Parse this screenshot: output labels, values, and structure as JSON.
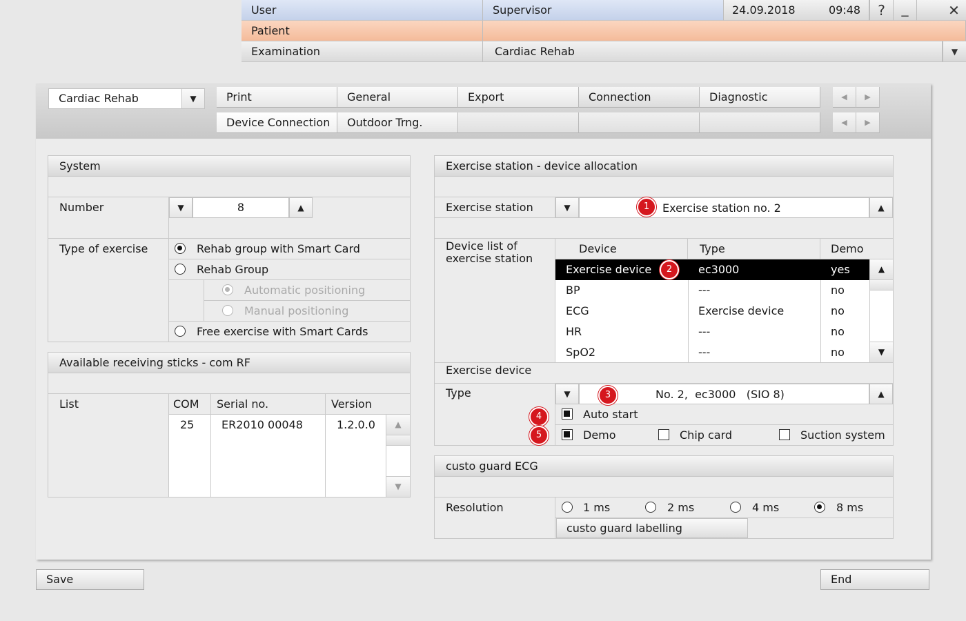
{
  "header": {
    "user_label": "User",
    "user_value": "Supervisor",
    "date": "24.09.2018",
    "time": "09:48",
    "help_icon": "?",
    "minimize_icon": "_",
    "close_icon": "✕",
    "patient_label": "Patient",
    "patient_value": "",
    "examination_label": "Examination",
    "examination_value": "Cardiac Rehab",
    "colors": {
      "blue": "#c4d1ea",
      "patient": "#f4bb9a"
    }
  },
  "module": {
    "selected": "Cardiac Rehab"
  },
  "tabs": {
    "row1": [
      "Print",
      "General",
      "Export",
      "Connection",
      "Diagnostic"
    ],
    "row2": [
      "Device Connection",
      "Outdoor Trng.",
      "",
      "",
      ""
    ],
    "active_row1": "Connection",
    "active_row2": "Device Connection"
  },
  "system": {
    "title": "System",
    "number_label": "Number",
    "number_value": "8",
    "type_label": "Type of exercise",
    "options": [
      {
        "label": "Rehab group with Smart Card",
        "selected": true
      },
      {
        "label": "Rehab Group",
        "selected": false
      },
      {
        "label": "Automatic positioning",
        "selected": true,
        "disabled": true
      },
      {
        "label": "Manual positioning",
        "selected": false,
        "disabled": true
      },
      {
        "label": "Free exercise with Smart Cards",
        "selected": false
      }
    ]
  },
  "sticks": {
    "title": "Available receiving sticks - com RF",
    "list_label": "List",
    "columns": [
      "COM",
      "Serial no.",
      "Version"
    ],
    "rows": [
      [
        "25",
        "ER2010 00048",
        "1.2.0.0"
      ]
    ]
  },
  "allocation": {
    "title": "Exercise station - device allocation",
    "station_label": "Exercise station",
    "station_value": "Exercise station no. 2",
    "device_list_label": "Device list of exercise station",
    "columns": [
      "Device",
      "Type",
      "Demo"
    ],
    "rows": [
      {
        "device": "Exercise device",
        "type": "ec3000",
        "demo": "yes",
        "selected": true
      },
      {
        "device": "BP",
        "type": "---",
        "demo": "no"
      },
      {
        "device": "ECG",
        "type": "Exercise device",
        "demo": "no"
      },
      {
        "device": "HR",
        "type": "---",
        "demo": "no"
      },
      {
        "device": "SpO2",
        "type": "---",
        "demo": "no"
      }
    ],
    "exercise_device_label": "Exercise device",
    "type_label": "Type",
    "type_value": "No. 2,  ec3000   (SIO 8)",
    "auto_start": {
      "label": "Auto start",
      "checked": true
    },
    "demo": {
      "label": "Demo",
      "checked": true
    },
    "chip_card": {
      "label": "Chip card",
      "checked": false
    },
    "suction": {
      "label": "Suction system",
      "checked": false
    }
  },
  "guard": {
    "title": "custo guard ECG",
    "resolution_label": "Resolution",
    "options": [
      {
        "label": "1 ms",
        "selected": false
      },
      {
        "label": "2 ms",
        "selected": false
      },
      {
        "label": "4 ms",
        "selected": false
      },
      {
        "label": "8 ms",
        "selected": true
      }
    ],
    "labelling_button": "custo guard labelling"
  },
  "badges": [
    "1",
    "2",
    "3",
    "4",
    "5"
  ],
  "footer": {
    "save": "Save",
    "end": "End"
  },
  "icons": {
    "arrow_down": "▼",
    "arrow_up": "▲",
    "arrow_left": "◀",
    "arrow_right": "▶"
  }
}
